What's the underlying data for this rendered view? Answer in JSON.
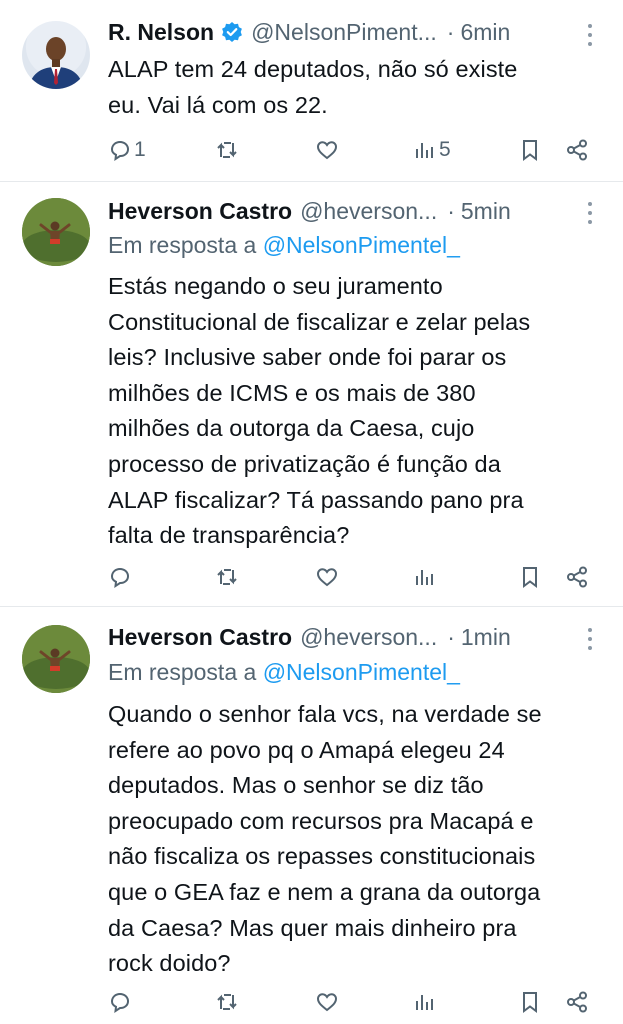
{
  "tweets": [
    {
      "name": "R. Nelson",
      "verified": true,
      "handle": "@NelsonPiment...",
      "separator": "·",
      "time": "6min",
      "reply_prefix": "",
      "reply_mention": "",
      "lines": [
        "ALAP tem 24 deputados, não só existe",
        "eu. Vai lá com os 22."
      ],
      "reply_count": "1",
      "views_count": "5"
    },
    {
      "name": "Heverson Castro",
      "verified": false,
      "handle": "@heverson...",
      "separator": "·",
      "time": "5min",
      "reply_prefix": "Em resposta a ",
      "reply_mention": "@NelsonPimentel_",
      "lines": [
        "Estás negando o seu juramento",
        "Constitucional de fiscalizar e zelar pelas",
        "leis? Inclusive saber onde foi parar os",
        "milhões de ICMS e os mais de 380",
        "milhões da outorga da Caesa, cujo",
        "processo de privatização é função da",
        "ALAP fiscalizar? Tá passando pano pra",
        "falta de transparência?"
      ],
      "reply_count": "",
      "views_count": ""
    },
    {
      "name": "Heverson Castro",
      "verified": false,
      "handle": "@heverson...",
      "separator": "·",
      "time": "1min",
      "reply_prefix": "Em resposta a ",
      "reply_mention": "@NelsonPimentel_",
      "lines": [
        "Quando o senhor fala vcs, na verdade se",
        "refere ao povo pq o Amapá elegeu 24",
        "deputados. Mas o senhor se diz tão",
        "preocupado com recursos pra Macapá e",
        "não fiscaliza os repasses constitucionais",
        "que o GEA faz e nem a grana da outorga",
        "da Caesa? Mas quer mais dinheiro pra",
        "rock doido?"
      ],
      "reply_count": "",
      "views_count": ""
    }
  ],
  "icons": [
    "reply-icon",
    "retweet-icon",
    "like-icon",
    "views-icon",
    "bookmark-icon",
    "share-icon",
    "more-icon",
    "verified-badge-icon"
  ],
  "colors": {
    "text": "#0f1419",
    "secondary": "#536471",
    "link": "#1d9bf0",
    "divider": "#e6e9ec"
  }
}
